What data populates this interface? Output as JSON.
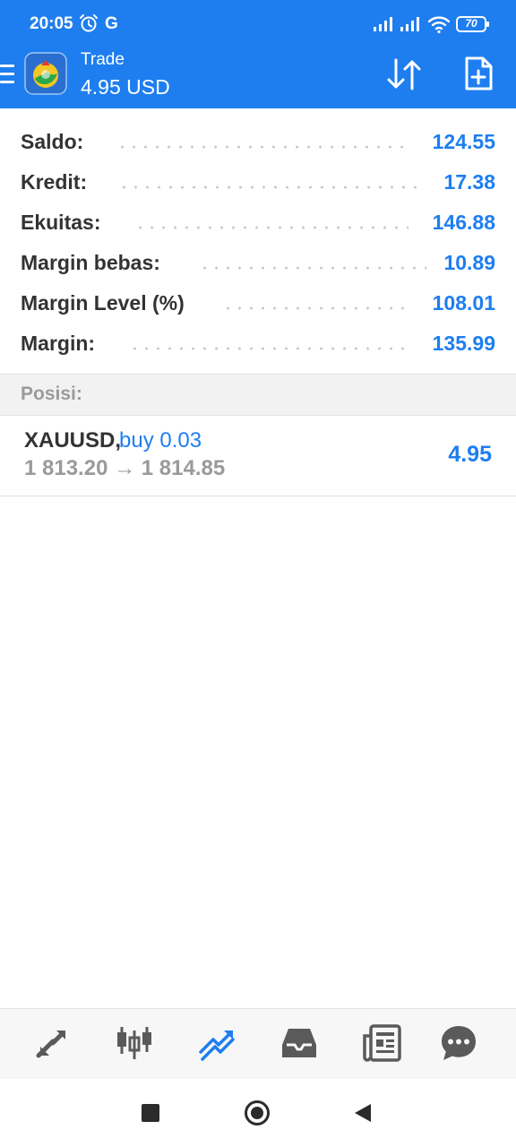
{
  "status_bar": {
    "time": "20:05",
    "carrier_letter": "G",
    "battery": "70"
  },
  "app_bar": {
    "title": "Trade",
    "subtitle": "4.95 USD"
  },
  "colors": {
    "accent": "#1e7ef0",
    "label": "#333333",
    "muted": "#9a9a9a"
  },
  "account": [
    {
      "label": "Saldo:",
      "value": "124.55"
    },
    {
      "label": "Kredit:",
      "value": "17.38"
    },
    {
      "label": "Ekuitas:",
      "value": "146.88"
    },
    {
      "label": "Margin bebas:",
      "value": "10.89"
    },
    {
      "label": "Margin Level (%)",
      "value": "108.01"
    },
    {
      "label": "Margin:",
      "value": "135.99"
    }
  ],
  "positions_header": "Posisi:",
  "position": {
    "symbol": "XAUUSD,",
    "direction": "buy 0.03",
    "prices": "1 813.20 → 1 814.85",
    "profit": "4.95"
  },
  "bottom_tabs": [
    {
      "icon": "quotes-icon",
      "active": false
    },
    {
      "icon": "chart-candles-icon",
      "active": false
    },
    {
      "icon": "trade-icon",
      "active": true
    },
    {
      "icon": "history-inbox-icon",
      "active": false
    },
    {
      "icon": "news-icon",
      "active": false
    },
    {
      "icon": "chat-icon",
      "active": false
    }
  ]
}
